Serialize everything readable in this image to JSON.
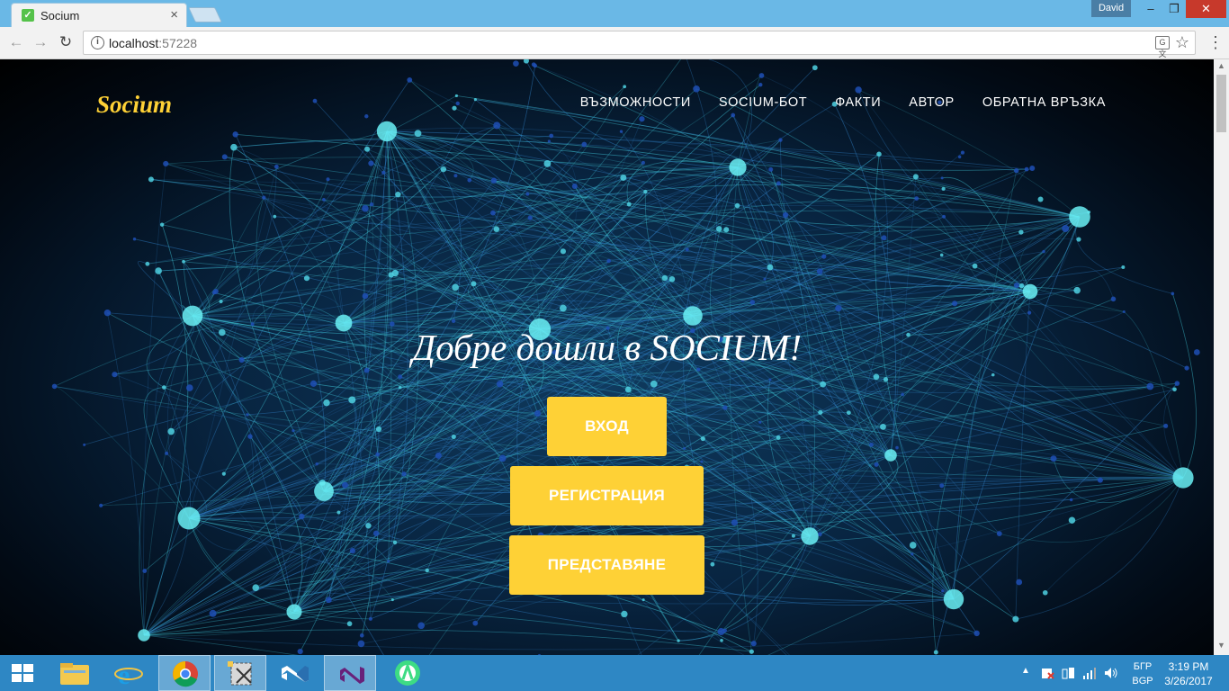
{
  "browser": {
    "tab_title": "Socium",
    "tab_close": "×",
    "user_name": "David",
    "url_host": "localhost",
    "url_port": ":57228",
    "window_min": "–",
    "window_max": "❐",
    "window_close": "✕"
  },
  "site": {
    "brand": "Socium",
    "nav": [
      {
        "label": "Възможности"
      },
      {
        "label": "Socium-бот"
      },
      {
        "label": "Факти"
      },
      {
        "label": "Автор"
      },
      {
        "label": "Обратна връзка"
      }
    ],
    "headline": "Добре дошли в SOCIUM!",
    "buttons": {
      "login": "Вход",
      "register": "Регистрация",
      "present": "Представяне"
    },
    "accent_color": "#fed136"
  },
  "taskbar": {
    "apps": [
      "file-explorer-icon",
      "internet-explorer-icon",
      "chrome-icon",
      "snipping-tool-icon",
      "vscode-icon",
      "visual-studio-icon",
      "android-studio-icon"
    ],
    "language_top": "БГР",
    "language_bottom": "BGP",
    "time": "3:19 PM",
    "date": "3/26/2017"
  }
}
